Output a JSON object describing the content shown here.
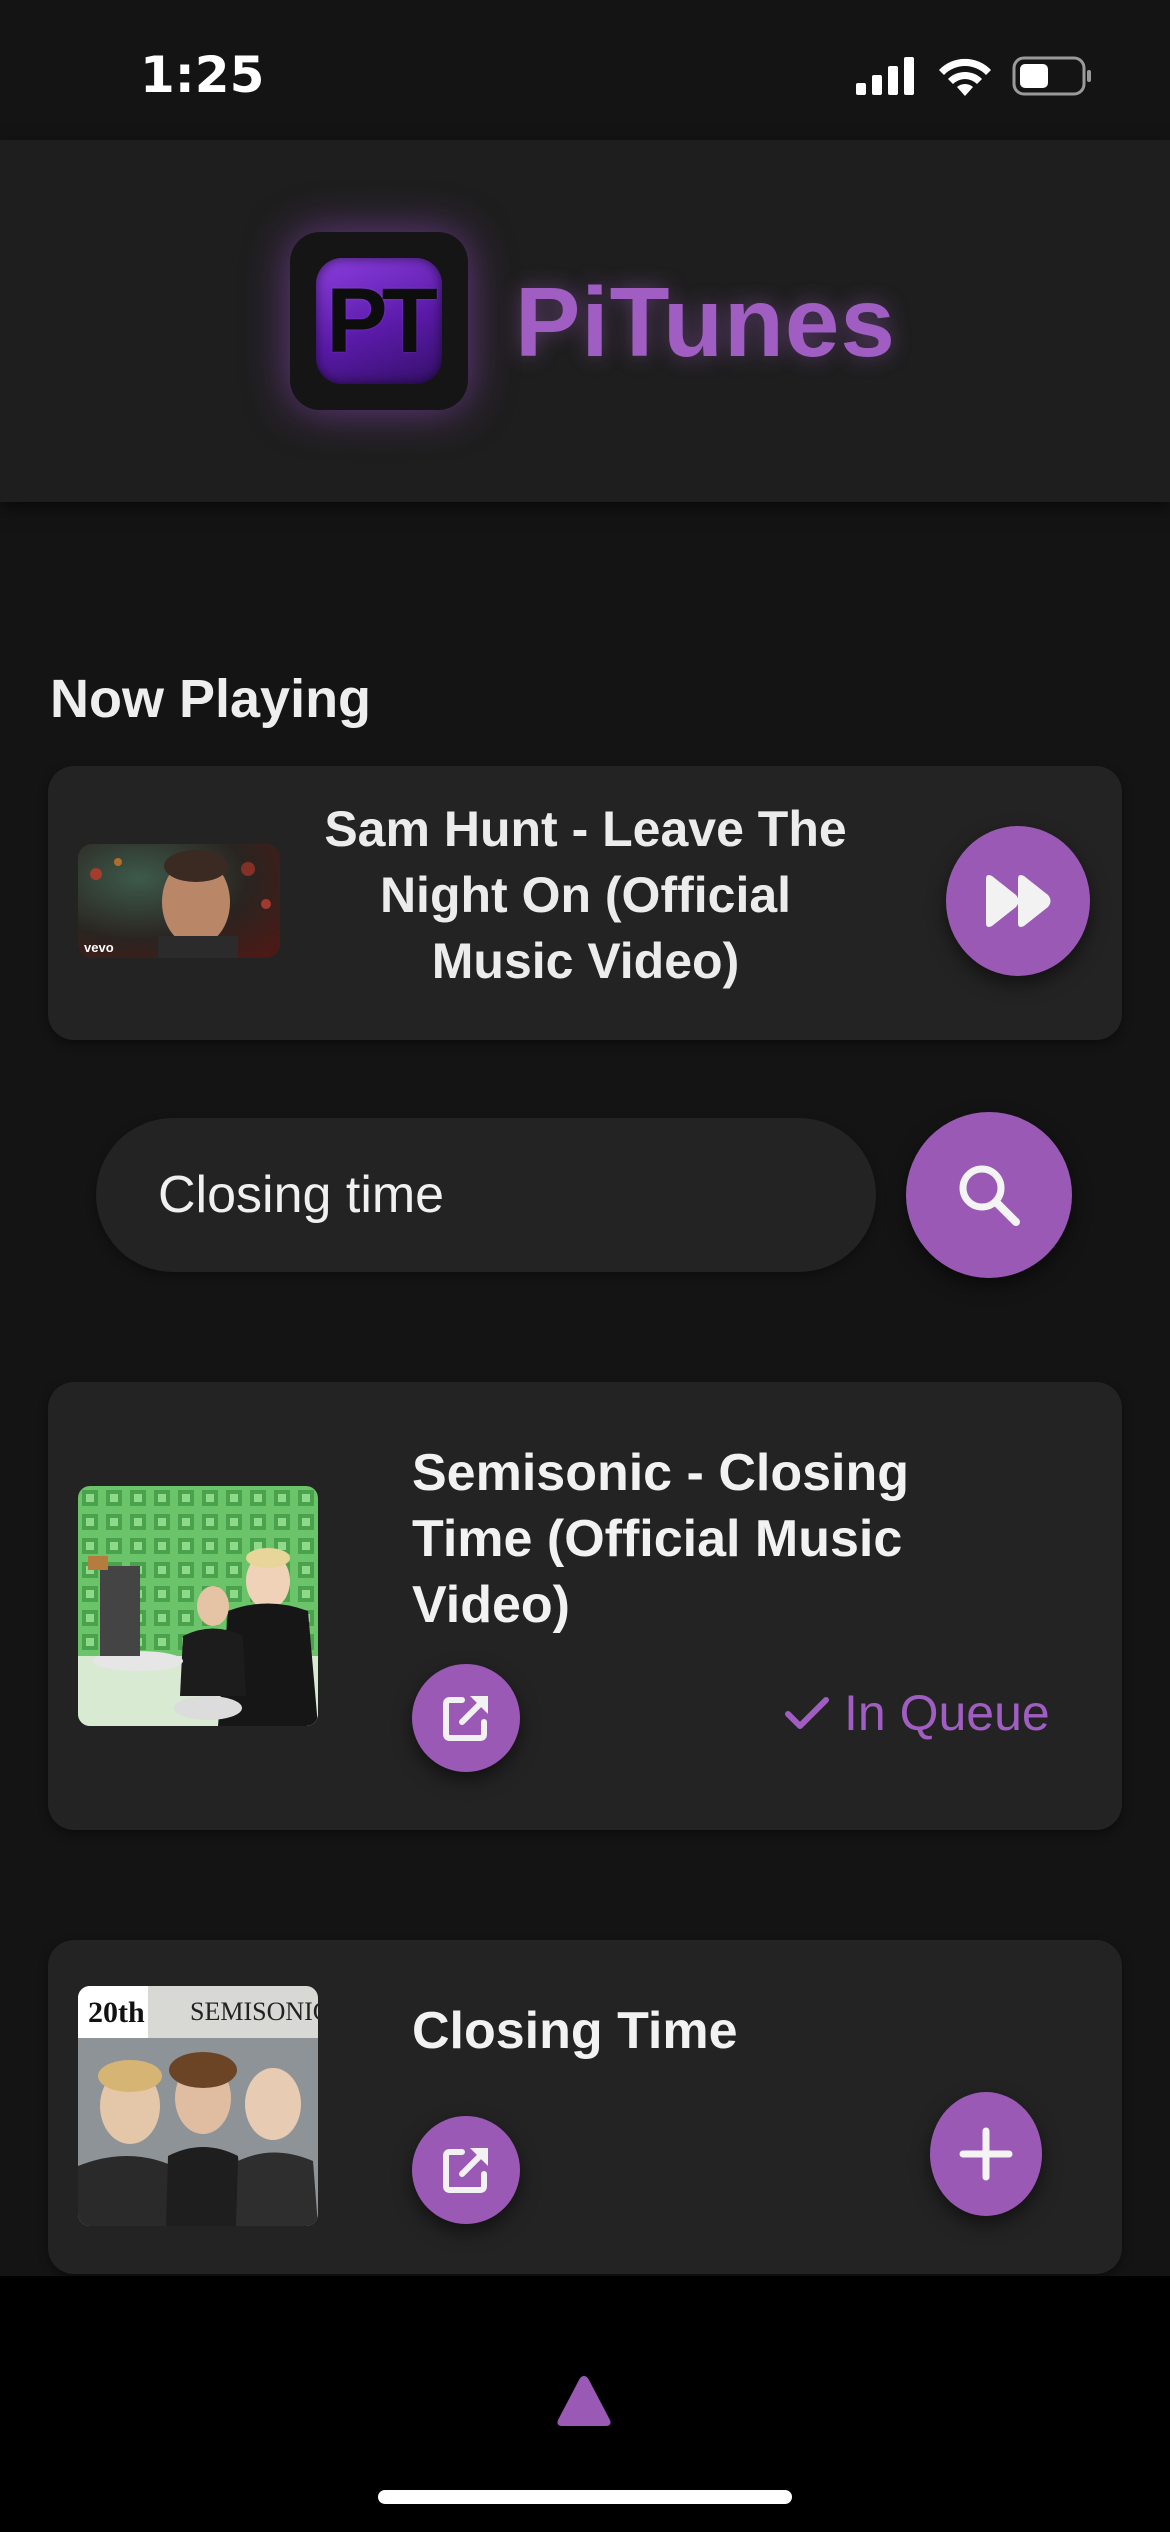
{
  "status_bar": {
    "time": "1:25",
    "icons": [
      "signal-icon",
      "wifi-icon",
      "battery-icon"
    ]
  },
  "header": {
    "logo_text": "PT",
    "app_name": "PiTunes"
  },
  "now_playing": {
    "section_title": "Now Playing",
    "track_title": "Sam Hunt - Leave The Night On (Official Music Video)",
    "thumbnail_badge": "vevo",
    "skip_icon": "fast-forward-icon"
  },
  "search": {
    "value": "Closing time",
    "button_icon": "search-icon"
  },
  "results": [
    {
      "title": "Semisonic - Closing Time (Official Music Video)",
      "open_icon": "external-link-icon",
      "status": "In Queue",
      "status_icon": "check-icon"
    },
    {
      "title": "Closing Time",
      "open_icon": "external-link-icon",
      "action_icon": "plus-icon",
      "album_art_text_1": "20th",
      "album_art_text_2": "SEMISONIC"
    }
  ],
  "bottom_bar": {
    "icon": "chevron-up-icon"
  },
  "colors": {
    "accent": "#9b59b6",
    "accent_text": "#a05ec3",
    "background": "#141414",
    "card": "#232323"
  }
}
